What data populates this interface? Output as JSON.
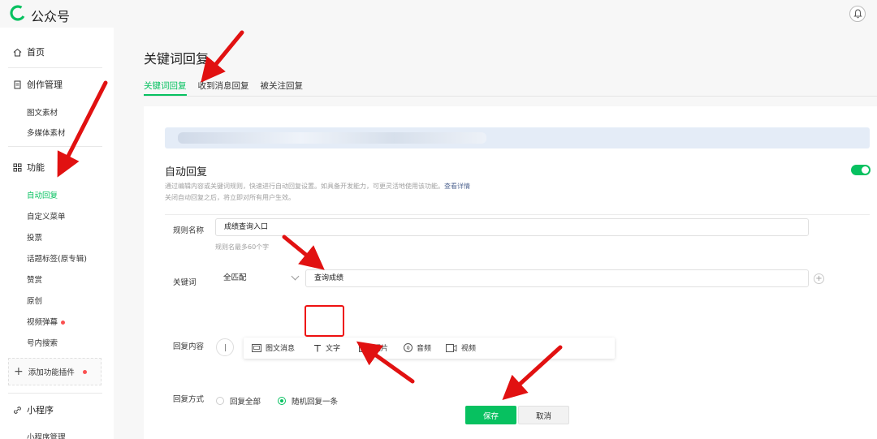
{
  "app": {
    "brand": "公众号",
    "brand_color": "#07c160"
  },
  "sidebar": {
    "home": "首页",
    "creation": {
      "label": "创作管理",
      "items": [
        "图文素材",
        "多媒体素材"
      ]
    },
    "features": {
      "label": "功能",
      "items": [
        {
          "label": "自动回复",
          "active": true
        },
        {
          "label": "自定义菜单"
        },
        {
          "label": "投票"
        },
        {
          "label": "话题标签(原专辑)"
        },
        {
          "label": "赞赏"
        },
        {
          "label": "原创"
        },
        {
          "label": "视频弹幕",
          "dot": true
        },
        {
          "label": "号内搜索"
        }
      ]
    },
    "add_plugin": "添加功能插件",
    "mini_program": {
      "label": "小程序",
      "items": [
        "小程序管理"
      ]
    }
  },
  "main": {
    "title": "关键词回复",
    "tabs": [
      "关键词回复",
      "收到消息回复",
      "被关注回复"
    ],
    "section_title": "自动回复",
    "desc_line1": "通过编辑内容或关键词规则，快速进行自动回复设置。如具备开发能力，可更灵活地使用该功能。",
    "desc_link": "查看详情",
    "desc_line2": "关闭自动回复之后，将立即对所有用户生效。",
    "form": {
      "rule_name_label": "规则名称",
      "rule_name_value": "成绩查询入口",
      "rule_name_hint": "规则名最多60个字",
      "keyword_label": "关键词",
      "match_mode": "全匹配",
      "keyword_value": "查询成绩",
      "reply_content_label": "回复内容",
      "reply_types": [
        "图文消息",
        "文字",
        "图片",
        "音频",
        "视频"
      ],
      "reply_mode_label": "回复方式",
      "reply_mode_options": [
        "回复全部",
        "随机回复一条"
      ],
      "reply_mode_selected": "随机回复一条"
    },
    "save_label": "保存",
    "cancel_label": "取消"
  },
  "colors": {
    "accent": "#07c160",
    "annotation": "#e11111",
    "link": "#576b95"
  },
  "icons": [
    "home-icon",
    "document-icon",
    "grid-icon",
    "link-icon",
    "bell-icon",
    "plus-icon",
    "picture-icon",
    "text-icon",
    "image-icon",
    "audio-icon",
    "video-icon"
  ]
}
